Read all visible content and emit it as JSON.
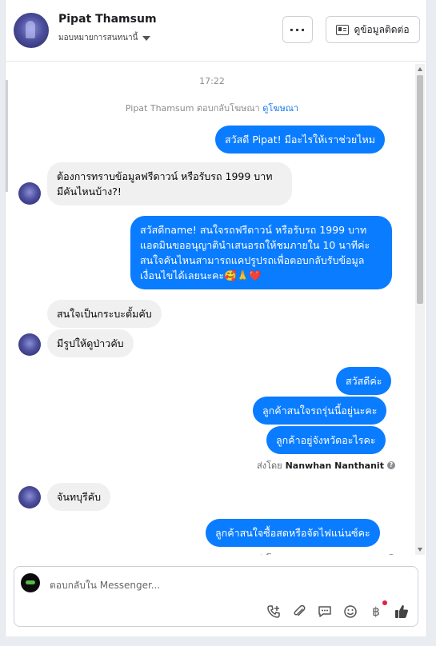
{
  "header": {
    "page_name": "Pipat Thamsum",
    "assigned_label": "มอบหมายการสนทนานี้",
    "more_label": "···",
    "contact_label": "ดูข้อมูลติดต่อ"
  },
  "thread": {
    "time": "17:22",
    "ad_reply_text": "Pipat Thamsum ตอบกลับโฆษณา",
    "ad_link": "ดูโฆษณา",
    "messages": [
      {
        "dir": "out",
        "text": "สวัสดี Pipat! มีอะไรให้เราช่วยไหม"
      },
      {
        "dir": "in",
        "text": "ต้องการทราบข้อมูลฟรีดาวน์ หรือรับรถ 1999 บาท\nมีคันไหนบ้าง?!"
      },
      {
        "dir": "out",
        "text": "สวัสดีname! สนใจรถฟรีดาวน์ หรือรับรถ 1999 บาท\nแอดมินขออนุญาตินำเสนอรถให้ชมภายใน 10 นาทีค่ะ\nสนใจคันไหนสามารถแคปรูปรถเพื่อตอบกลับรับข้อมูล\nเงื่อนไขได้เลยนะคะ🥰🙏❤️"
      },
      {
        "dir": "in",
        "text": "สนใจเป็นกระบะตั้มคับ"
      },
      {
        "dir": "in",
        "text": "มีรูปให้ดูป่าวคับ"
      },
      {
        "dir": "out",
        "text": "สวัสดีค่ะ"
      },
      {
        "dir": "out",
        "text": "ลูกค้าสนใจรถรุ่นนี้อยู่นะคะ"
      },
      {
        "dir": "out",
        "text": "ลูกค้าอยู่จังหวัดอะไรคะ"
      },
      {
        "dir": "in",
        "text": "จันทบุรีคับ"
      },
      {
        "dir": "out",
        "text": "ลูกค้าสนใจซื้อสดหรือจัดไฟแน่นซ์คะ"
      }
    ],
    "sent_by_prefix": "ส่งโดย",
    "sent_by_name": "Nanwhan Nanthanit"
  },
  "composer": {
    "placeholder": "ตอบกลับใน Messenger...",
    "icons": [
      "add-call-icon",
      "attachment-icon",
      "saved-reply-icon",
      "emoji-icon",
      "baht-icon",
      "like-icon"
    ]
  },
  "colors": {
    "outgoing_bubble": "#0a7cff",
    "incoming_bubble": "#f0f0f0",
    "link": "#1877f2"
  }
}
